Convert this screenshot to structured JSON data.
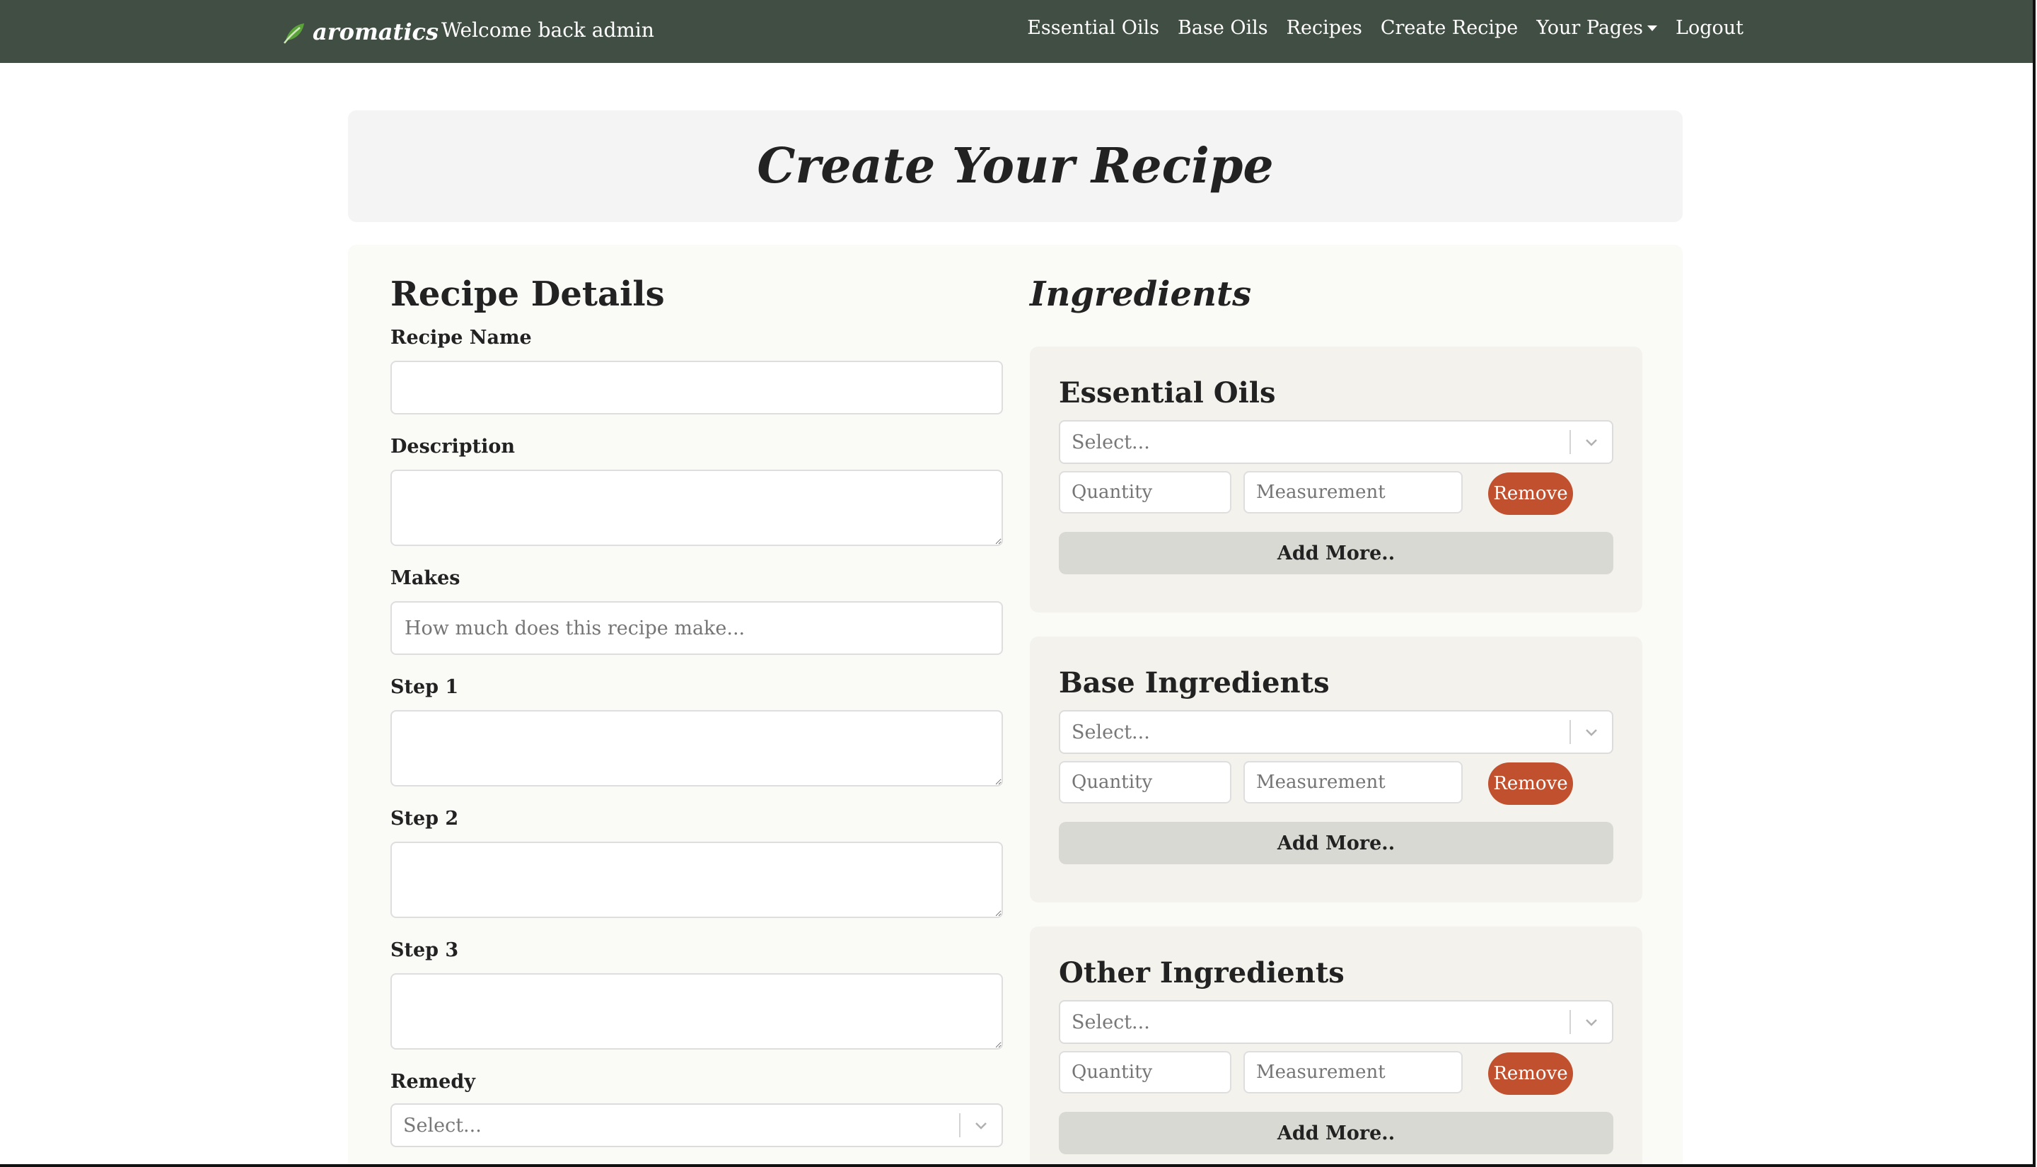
{
  "navbar": {
    "brand": "aromatics",
    "welcome": "Welcome back admin",
    "links": [
      "Essential Oils",
      "Base Oils",
      "Recipes",
      "Create Recipe"
    ],
    "your_pages": "Your Pages",
    "logout": "Logout"
  },
  "page": {
    "title": "Create Your Recipe"
  },
  "details": {
    "heading": "Recipe Details",
    "recipe_name_label": "Recipe Name",
    "recipe_name_value": "",
    "description_label": "Description",
    "makes_label": "Makes",
    "makes_placeholder": "How much does this recipe make...",
    "step1_label": "Step 1",
    "step2_label": "Step 2",
    "step3_label": "Step 3",
    "remedy_label": "Remedy",
    "remedy_placeholder": "Select..."
  },
  "ingredients": {
    "heading": "Ingredients",
    "groups": [
      {
        "title": "Essential Oils",
        "select_placeholder": "Select...",
        "quantity_placeholder": "Quantity",
        "measurement_placeholder": "Measurement",
        "remove_label": "Remove",
        "add_label": "Add More.."
      },
      {
        "title": "Base Ingredients",
        "select_placeholder": "Select...",
        "quantity_placeholder": "Quantity",
        "measurement_placeholder": "Measurement",
        "remove_label": "Remove",
        "add_label": "Add More.."
      },
      {
        "title": "Other Ingredients",
        "select_placeholder": "Select...",
        "quantity_placeholder": "Quantity",
        "measurement_placeholder": "Measurement",
        "remove_label": "Remove",
        "add_label": "Add More.."
      }
    ]
  },
  "colors": {
    "navbar": "#414e44",
    "remove_button": "#c0502e",
    "add_button": "#d9d9d4",
    "brand_leaf": "#5aa33a"
  },
  "icons": {
    "brand": "leaf-icon",
    "select_arrow": "chevron-down-icon",
    "dropdown": "caret-down-icon"
  }
}
